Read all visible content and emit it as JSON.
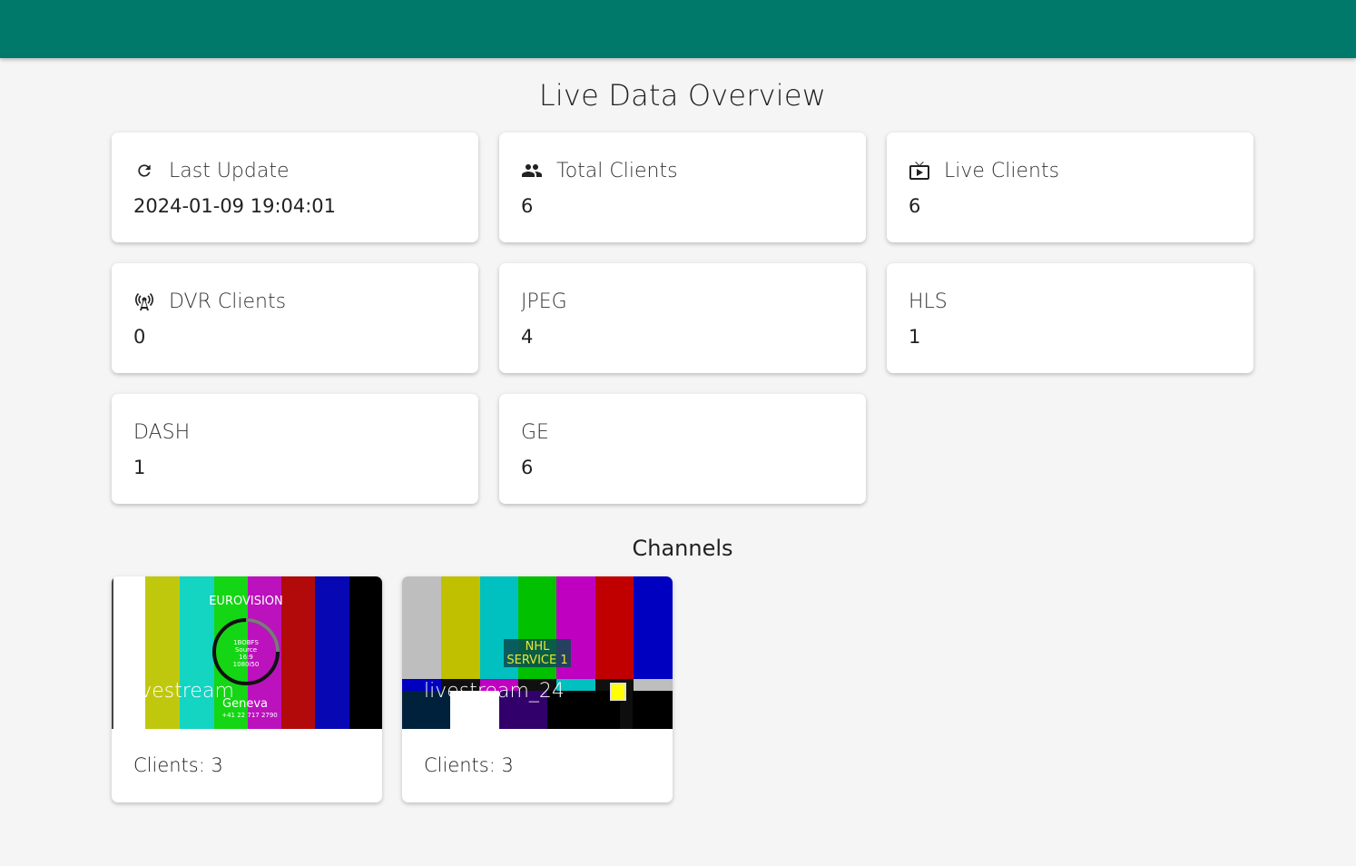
{
  "header": {
    "title": ""
  },
  "page": {
    "title": "Live Data Overview"
  },
  "stats": [
    {
      "label": "Last Update",
      "value": "2024-01-09 19:04:01",
      "icon": "refresh-icon"
    },
    {
      "label": "Total Clients",
      "value": "6",
      "icon": "people-icon"
    },
    {
      "label": "Live Clients",
      "value": "6",
      "icon": "live-tv-icon"
    },
    {
      "label": "DVR Clients",
      "value": "0",
      "icon": "antenna-icon"
    },
    {
      "label": "JPEG",
      "value": "4"
    },
    {
      "label": "HLS",
      "value": "1"
    },
    {
      "label": "DASH",
      "value": "1"
    },
    {
      "label": "GE",
      "value": "6"
    }
  ],
  "channels_section": {
    "title": "Channels"
  },
  "channels": [
    {
      "name": "livestream",
      "clients": "Clients: 3",
      "thumb": {
        "brand": "EUROVISION",
        "circle_lines": [
          "1BOBFS",
          "Source",
          "16:9",
          "1080i50"
        ],
        "city": "Geneva",
        "phone": "+41 22 717 2790"
      }
    },
    {
      "name": "livestream_24",
      "clients": "Clients: 3",
      "thumb": {
        "line1": "NHL",
        "line2": "SERVICE 1"
      }
    }
  ],
  "colors": {
    "topbar": "#00796b",
    "background": "#f5f5f5",
    "card": "#ffffff"
  }
}
